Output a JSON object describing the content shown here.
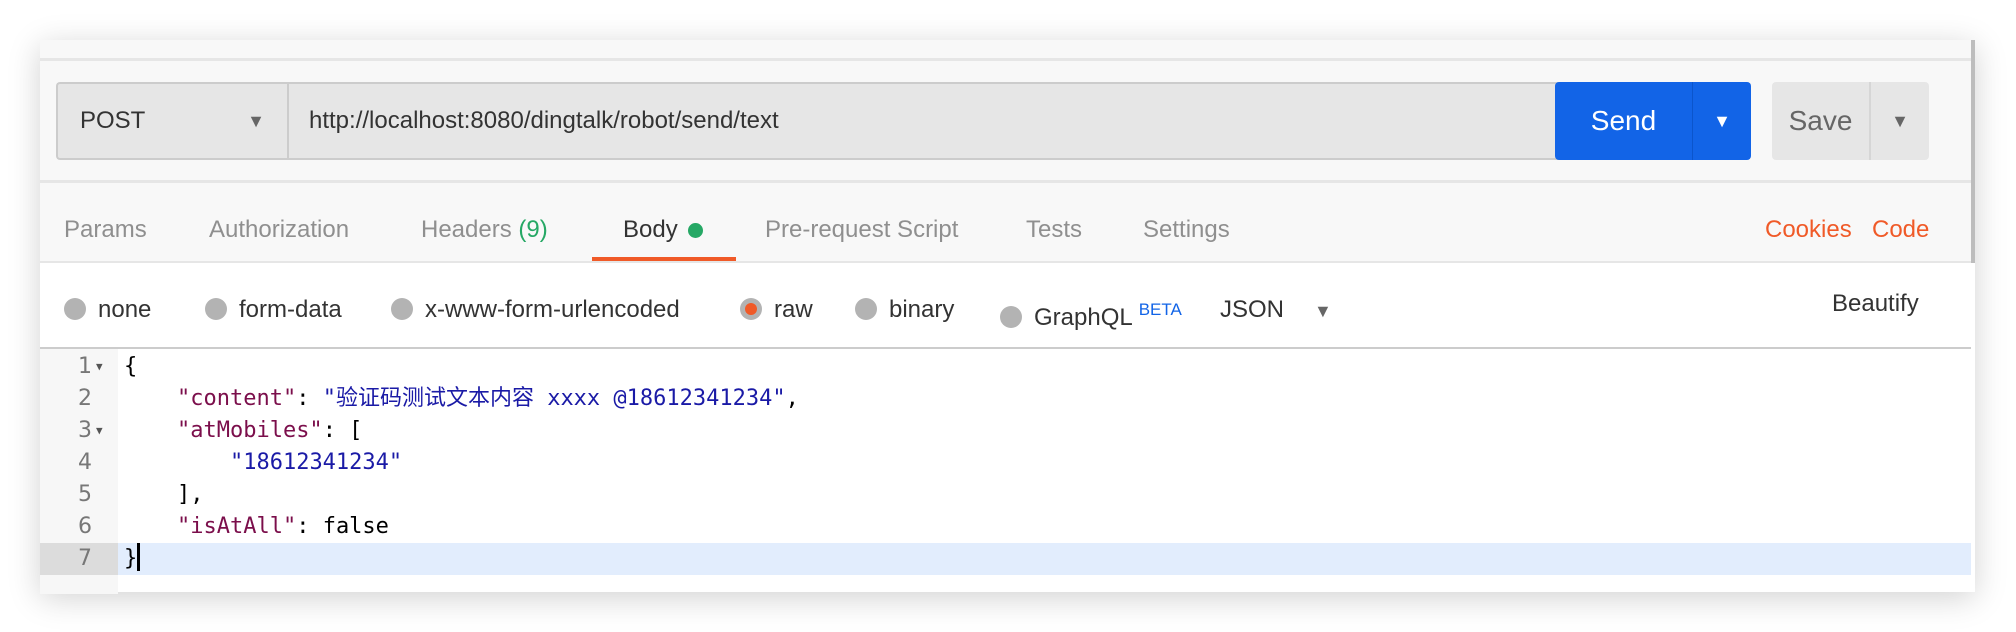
{
  "request": {
    "method": "POST",
    "method_icon": "triangle-down",
    "url": "http://localhost:8080/dingtalk/robot/send/text",
    "send_label": "Send",
    "save_label": "Save"
  },
  "tabs": [
    {
      "label": "Params"
    },
    {
      "label": "Authorization"
    },
    {
      "label": "Headers",
      "count": "(9)"
    },
    {
      "label": "Body",
      "active": true
    },
    {
      "label": "Pre-request Script"
    },
    {
      "label": "Tests"
    },
    {
      "label": "Settings"
    }
  ],
  "links": {
    "cookies": "Cookies",
    "code": "Code",
    "beautify": "Beautify"
  },
  "body_types": [
    {
      "label": "none"
    },
    {
      "label": "form-data"
    },
    {
      "label": "x-www-form-urlencoded"
    },
    {
      "label": "raw",
      "selected": true
    },
    {
      "label": "binary"
    },
    {
      "label": "GraphQL",
      "badge": "BETA"
    }
  ],
  "format": "JSON",
  "colors": {
    "accent": "#f05a28",
    "send": "#1264e7",
    "dot": "#26a865"
  },
  "editor": {
    "lines": [
      {
        "n": "1",
        "t": "{"
      },
      {
        "n": "2",
        "key": "\"content\"",
        "sep": ": ",
        "val": "\"验证码测试文本内容 xxxx @18612341234\"",
        "end": ","
      },
      {
        "n": "3",
        "key": "\"atMobiles\"",
        "sep": ": ["
      },
      {
        "n": "4",
        "val": "\"18612341234\""
      },
      {
        "n": "5",
        "t": "],"
      },
      {
        "n": "6",
        "key": "\"isAtAll\"",
        "sep": ": false"
      },
      {
        "n": "7",
        "t": "}"
      }
    ]
  }
}
